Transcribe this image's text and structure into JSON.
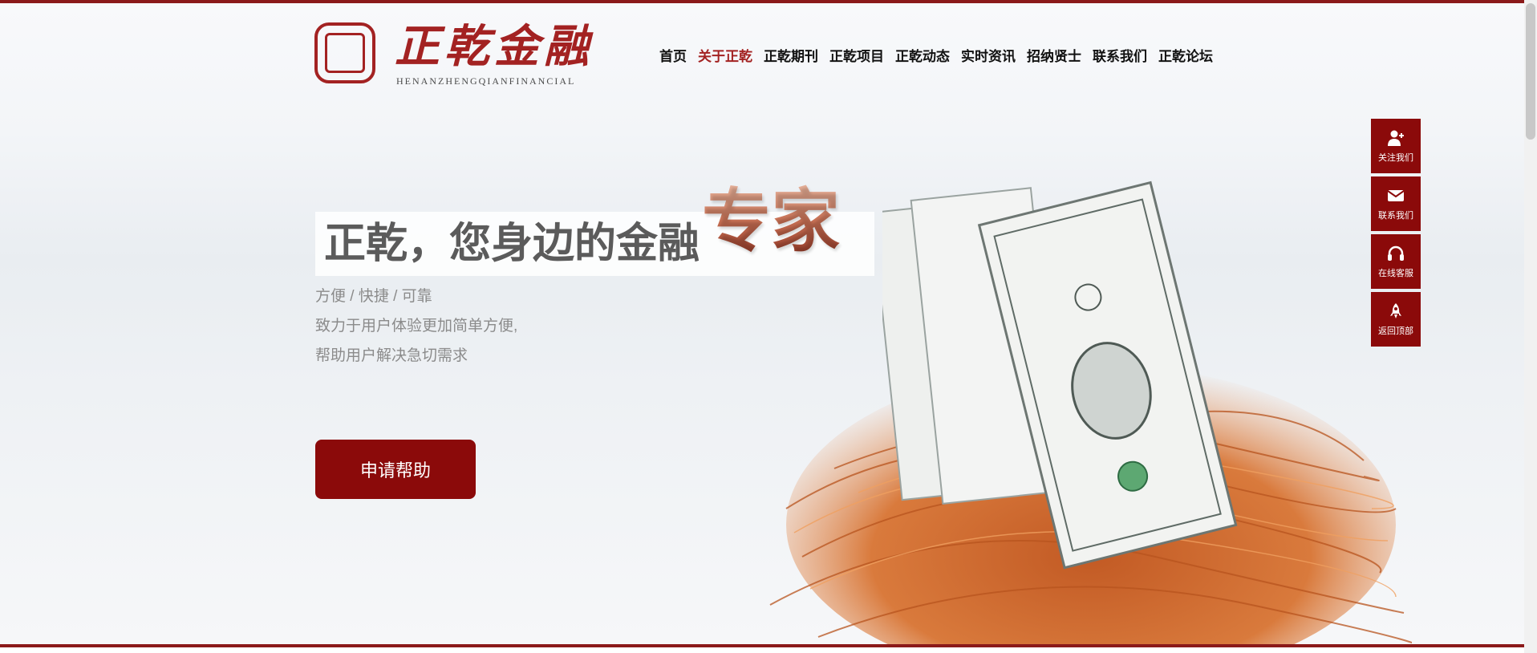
{
  "brand": {
    "logo_cn": "正乾金融",
    "logo_en": "HENANZHENGQIANFINANCIAL"
  },
  "nav": {
    "items": [
      {
        "label": "首页",
        "active": false
      },
      {
        "label": "关于正乾",
        "active": true
      },
      {
        "label": "正乾期刊",
        "active": false
      },
      {
        "label": "正乾项目",
        "active": false
      },
      {
        "label": "正乾动态",
        "active": false
      },
      {
        "label": "实时资讯",
        "active": false
      },
      {
        "label": "招纳贤士",
        "active": false
      },
      {
        "label": "联系我们",
        "active": false
      },
      {
        "label": "正乾论坛",
        "active": false
      }
    ]
  },
  "hero": {
    "headline_main": "正乾，您身边的金融",
    "headline_accent": "专家",
    "tagline": "方便 / 快捷 / 可靠",
    "desc_line1": "致力于用户体验更加简单方便,",
    "desc_line2": "帮助用户解决急切需求",
    "cta_label": "申请帮助"
  },
  "side_toolbar": {
    "items": [
      {
        "label": "关注我们",
        "icon": "add-user-icon"
      },
      {
        "label": "联系我们",
        "icon": "mail-icon"
      },
      {
        "label": "在线客服",
        "icon": "headset-icon"
      },
      {
        "label": "返回顶部",
        "icon": "rocket-icon"
      }
    ]
  },
  "colors": {
    "brand_red": "#8b0a0a",
    "accent_red": "#a32222"
  }
}
